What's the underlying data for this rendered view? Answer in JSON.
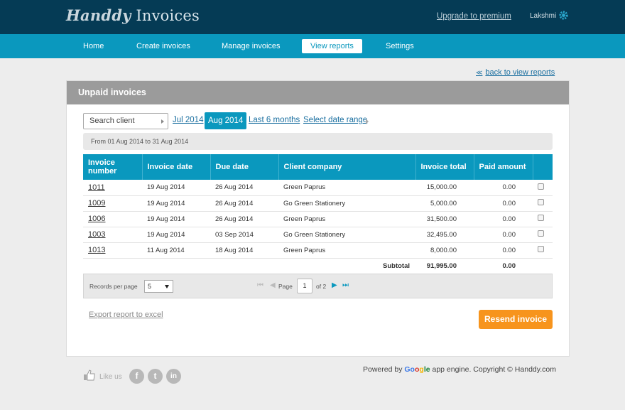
{
  "header": {
    "logo_script": "Handdy",
    "logo_text": "Invoices",
    "upgrade": "Upgrade to premium",
    "user": "Lakshmi"
  },
  "nav": [
    "Home",
    "Create invoices",
    "Manage invoices",
    "View reports",
    "Settings"
  ],
  "nav_active": "View reports",
  "back_link": "back to view reports",
  "panel": {
    "title": "Unpaid invoices",
    "search_placeholder": "Search client",
    "periods": [
      "Jul 2014",
      "Aug 2014",
      "Last 6 months",
      "Select date range"
    ],
    "active_period": "Aug 2014",
    "date_range": "From 01 Aug 2014 to 31 Aug 2014"
  },
  "table": {
    "headers": [
      "Invoice number",
      "Invoice date",
      "Due date",
      "Client company",
      "Invoice total",
      "Paid amount"
    ],
    "header_line1": "Invoice",
    "header_line2": "number",
    "rows": [
      [
        "1011",
        "19 Aug 2014",
        "26 Aug 2014",
        "Green Paprus",
        "15,000.00",
        "0.00"
      ],
      [
        "1009",
        "19 Aug 2014",
        "26 Aug 2014",
        "Go Green Stationery",
        "5,000.00",
        "0.00"
      ],
      [
        "1006",
        "19 Aug 2014",
        "26 Aug 2014",
        "Green Paprus",
        "31,500.00",
        "0.00"
      ],
      [
        "1003",
        "19 Aug 2014",
        "03 Sep 2014",
        "Go Green Stationery",
        "32,495.00",
        "0.00"
      ],
      [
        "1013",
        "11 Aug 2014",
        "18 Aug 2014",
        "Green Paprus",
        "8,000.00",
        "0.00"
      ]
    ],
    "subtotal_label": "Subtotal",
    "subtotal_total": "91,995.00",
    "subtotal_paid": "0.00"
  },
  "pager": {
    "records_label": "Records per page",
    "records_value": "5",
    "page_label": "Page",
    "page_value": "1",
    "of_label": "of 2"
  },
  "export_link": "Export report to excel",
  "resend_button": "Resend invoice",
  "footer": {
    "like_us": "Like us",
    "social": [
      "f",
      "t",
      "in"
    ],
    "powered_prefix": "Powered by",
    "google": [
      "Go",
      "o",
      "g",
      "le"
    ],
    "powered_suffix": "app engine. Copyright © Handdy.com"
  },
  "colors": {
    "header_bg": "#053b55",
    "nav_bg": "#0a98be",
    "panel_head": "#9b9b9b",
    "resend": "#f7941d"
  }
}
